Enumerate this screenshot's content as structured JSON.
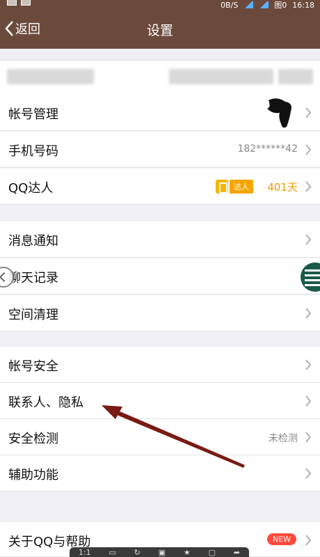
{
  "statusbar": {
    "net_speed": "0B/S",
    "time": "16:18",
    "clock_label": "图0"
  },
  "navbar": {
    "back_label": "返回",
    "title": "设置"
  },
  "sections": {
    "account": [
      {
        "label": "帐号管理"
      },
      {
        "label": "手机号码",
        "value": "182******42"
      },
      {
        "label": "QQ达人",
        "badge": "达人",
        "days": "401天"
      }
    ],
    "messages": [
      {
        "label": "消息通知"
      },
      {
        "label": "聊天记录"
      },
      {
        "label": "空间清理"
      }
    ],
    "security": [
      {
        "label": "帐号安全"
      },
      {
        "label": "联系人、隐私"
      },
      {
        "label": "安全检测",
        "value": "未检测"
      },
      {
        "label": "辅助功能"
      }
    ],
    "about": [
      {
        "label": "关于QQ与帮助",
        "badge": "NEW"
      }
    ]
  },
  "bottombar": {
    "zoom": "1:1"
  },
  "colors": {
    "header": "#6b4a3c",
    "badge_orange": "#f6a500",
    "new_badge": "#ff4a3c",
    "annotation_arrow": "#7a1a14"
  }
}
